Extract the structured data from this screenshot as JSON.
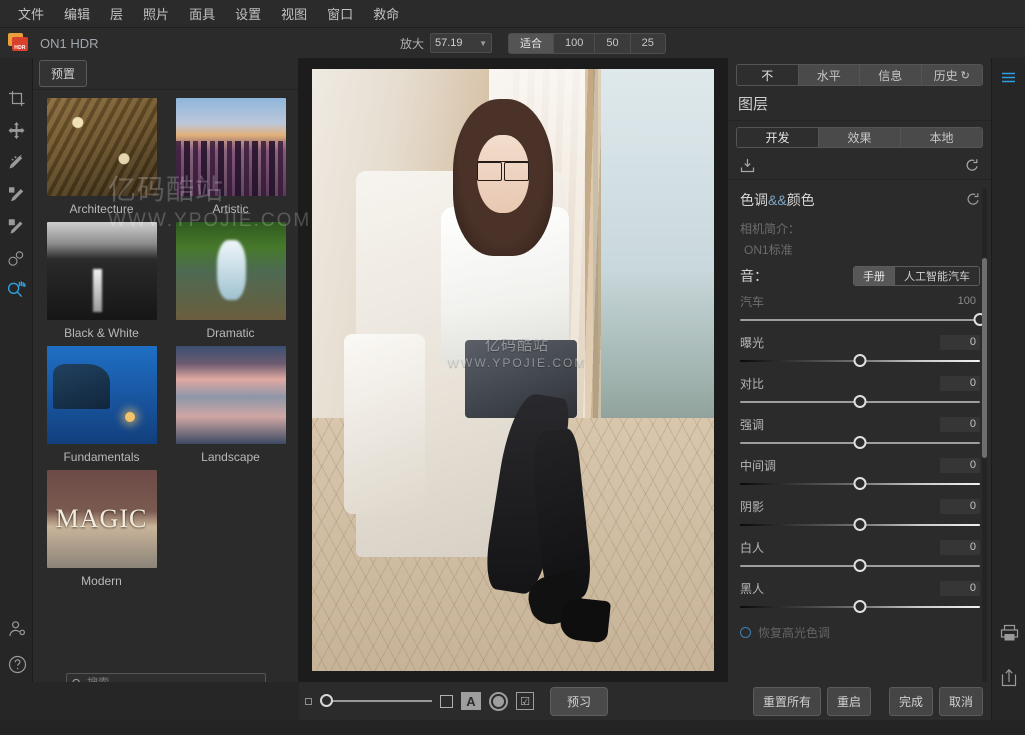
{
  "app": {
    "title": "ON1 HDR",
    "logo_badge": "HDR"
  },
  "menu": {
    "items": [
      {
        "label": "文件",
        "name": "menu-file"
      },
      {
        "label": "编辑",
        "name": "menu-edit"
      },
      {
        "label": "层",
        "name": "menu-layer"
      },
      {
        "label": "照片",
        "name": "menu-photo"
      },
      {
        "label": "面具",
        "name": "menu-mask"
      },
      {
        "label": "设置",
        "name": "menu-settings"
      },
      {
        "label": "视图",
        "name": "menu-view"
      },
      {
        "label": "窗口",
        "name": "menu-window"
      },
      {
        "label": "救命",
        "name": "menu-help"
      }
    ]
  },
  "zoom_toolbar": {
    "label": "放大",
    "value": "57.19",
    "presets": [
      {
        "label": "适合",
        "active": true
      },
      {
        "label": "100",
        "active": false
      },
      {
        "label": "50",
        "active": false
      },
      {
        "label": "25",
        "active": false
      }
    ]
  },
  "left_tools": [
    {
      "name": "crop-tool-icon",
      "title": "裁剪"
    },
    {
      "name": "move-tool-icon",
      "title": "移动"
    },
    {
      "name": "retouch-brush-icon",
      "title": "修饰画笔"
    },
    {
      "name": "perfect-brush-icon",
      "title": "完美画笔"
    },
    {
      "name": "masking-brush-icon",
      "title": "遮罩画笔"
    },
    {
      "name": "blemish-remover-icon",
      "title": "污点去除"
    },
    {
      "name": "zoom-tool-icon",
      "title": "缩放",
      "active": true
    }
  ],
  "presets_panel": {
    "tab_label": "预置",
    "search_placeholder": "搜索",
    "search_value": "",
    "items": [
      {
        "label": "Architecture",
        "thumb": "t-arch"
      },
      {
        "label": "Artistic",
        "thumb": "t-art"
      },
      {
        "label": "Black & White",
        "thumb": "t-bw"
      },
      {
        "label": "Dramatic",
        "thumb": "t-dram"
      },
      {
        "label": "Fundamentals",
        "thumb": "t-fund"
      },
      {
        "label": "Landscape",
        "thumb": "t-land"
      },
      {
        "label": "Modern",
        "thumb": "t-mod",
        "thumb_text": "MAGIC"
      }
    ]
  },
  "watermark": {
    "line1": "亿码酷站",
    "line2": "WWW.YPOJIE.COM"
  },
  "canvas_bottom_bar": {
    "preview_label": "预习",
    "icons": [
      {
        "name": "thumbnail-small-icon"
      },
      {
        "name": "thumbnail-large-icon"
      },
      {
        "name": "text-overlay-icon",
        "glyph": "A"
      },
      {
        "name": "soft-proof-icon"
      },
      {
        "name": "checkmark-toggle-icon",
        "glyph": "☑"
      }
    ]
  },
  "right_panel": {
    "tabs": [
      {
        "label": "不",
        "active": true
      },
      {
        "label": "水平",
        "active": false
      },
      {
        "label": "信息",
        "active": false
      },
      {
        "label": "历史",
        "active": false,
        "icon": "undo-icon"
      }
    ],
    "section_title": "图层",
    "mode_tabs": [
      {
        "label": "开发",
        "active": true
      },
      {
        "label": "效果",
        "active": false
      },
      {
        "label": "本地",
        "active": false
      }
    ],
    "toolbar_icons": [
      {
        "name": "save-preset-icon"
      },
      {
        "name": "reset-panel-icon"
      }
    ],
    "group": {
      "title_part1": "色调",
      "title_amp": "&&",
      "title_part2": "颜色",
      "reset_icon": "reset-group-icon",
      "camera_profile_label": "相机简介：",
      "camera_profile_value": "ON1标准",
      "tone_label": "音：",
      "tone_modes": [
        {
          "label": "手册",
          "active": true
        },
        {
          "label": "人工智能汽车",
          "active": false
        }
      ],
      "auto_slider": {
        "label": "汽车",
        "value": "100",
        "pos": 100
      },
      "sliders": [
        {
          "label": "曝光",
          "value": "0",
          "pos": 50,
          "gradient": true
        },
        {
          "label": "对比",
          "value": "0",
          "pos": 50,
          "gradient": false
        },
        {
          "label": "强调",
          "value": "0",
          "pos": 50,
          "gradient": false
        },
        {
          "label": "中间调",
          "value": "0",
          "pos": 50,
          "gradient": true
        },
        {
          "label": "阴影",
          "value": "0",
          "pos": 50,
          "gradient": true
        },
        {
          "label": "白人",
          "value": "0",
          "pos": 50,
          "gradient": false
        },
        {
          "label": "黑人",
          "value": "0",
          "pos": 50,
          "gradient": true
        }
      ],
      "recover_option": {
        "label": "恢复高光色调",
        "checked": false
      }
    }
  },
  "right_strip_icons": [
    {
      "name": "adjustments-panel-icon",
      "active": true
    },
    {
      "name": "print-icon",
      "active": false
    },
    {
      "name": "share-export-icon",
      "active": false
    }
  ],
  "footer_buttons": [
    {
      "label": "重置所有",
      "name": "reset-all-button"
    },
    {
      "label": "重启",
      "name": "restart-button"
    },
    {
      "label": "完成",
      "name": "done-button"
    },
    {
      "label": "取消",
      "name": "cancel-button"
    }
  ],
  "bottom_left_icons": [
    {
      "name": "account-icon"
    },
    {
      "name": "help-icon"
    },
    {
      "name": "view-split-icon"
    },
    {
      "name": "view-compare-icon"
    },
    {
      "name": "view-single-icon",
      "active": true
    }
  ]
}
